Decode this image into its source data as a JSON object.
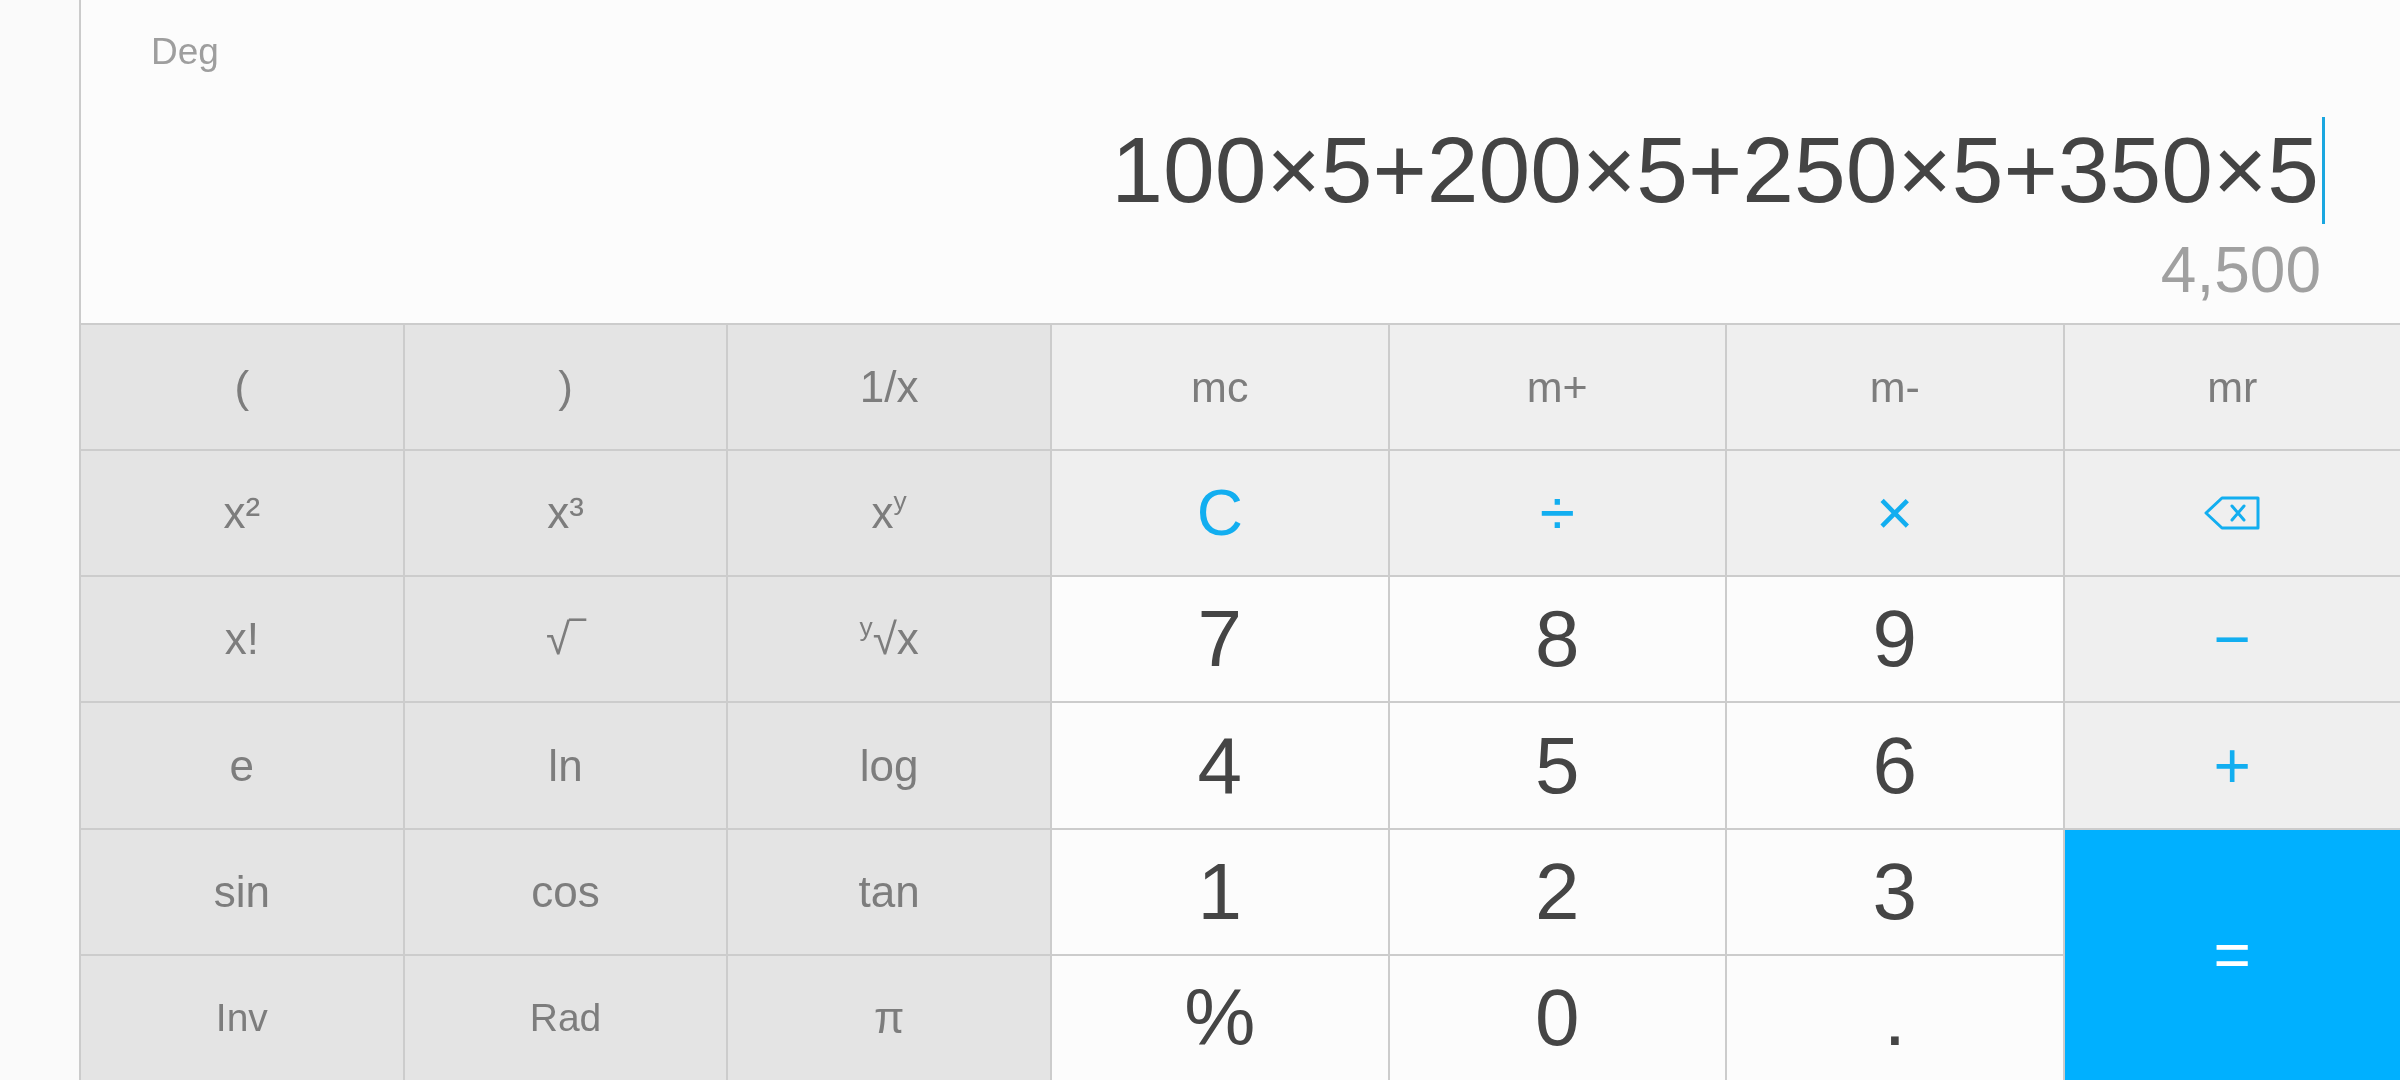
{
  "display": {
    "angle_mode": "Deg",
    "expression": "100×5+200×5+250×5+350×5",
    "result": "4,500"
  },
  "scientific_keys": [
    {
      "kind": "function",
      "label": "("
    },
    {
      "kind": "function",
      "label": ")"
    },
    {
      "kind": "function",
      "label": "1/x"
    },
    {
      "kind": "function",
      "label": "x²"
    },
    {
      "kind": "function",
      "label": "x³"
    },
    {
      "kind": "function",
      "label": "x$^{y}$"
    },
    {
      "kind": "function",
      "label": "x!"
    },
    {
      "kind": "function",
      "label": "√‾"
    },
    {
      "kind": "function",
      "label": "$^{y}$√x"
    },
    {
      "kind": "function",
      "label": "e"
    },
    {
      "kind": "function",
      "label": "ln"
    },
    {
      "kind": "function",
      "label": "log"
    },
    {
      "kind": "function",
      "label": "sin"
    },
    {
      "kind": "function",
      "label": "cos"
    },
    {
      "kind": "function",
      "label": "tan"
    },
    {
      "kind": "mode",
      "label": "Inv"
    },
    {
      "kind": "mode",
      "label": "Rad"
    },
    {
      "kind": "function",
      "label": "π"
    }
  ],
  "main_keys": [
    {
      "kind": "memory",
      "label": "mc"
    },
    {
      "kind": "memory",
      "label": "m+"
    },
    {
      "kind": "memory",
      "label": "m-"
    },
    {
      "kind": "memory",
      "label": "mr"
    },
    {
      "kind": "operator",
      "label": "C"
    },
    {
      "kind": "operator",
      "label": "÷"
    },
    {
      "kind": "operator",
      "label": "×"
    },
    {
      "kind": "backspace"
    },
    {
      "kind": "numpad",
      "label": "7"
    },
    {
      "kind": "numpad",
      "label": "8"
    },
    {
      "kind": "numpad",
      "label": "9"
    },
    {
      "kind": "operator",
      "label": "−"
    },
    {
      "kind": "numpad",
      "label": "4"
    },
    {
      "kind": "numpad",
      "label": "5"
    },
    {
      "kind": "numpad",
      "label": "6"
    },
    {
      "kind": "operator",
      "label": "+"
    },
    {
      "kind": "numpad",
      "label": "1"
    },
    {
      "kind": "numpad",
      "label": "2"
    },
    {
      "kind": "numpad",
      "label": "3"
    },
    {
      "kind": "equals",
      "label": "="
    },
    {
      "kind": "numpad",
      "label": "%"
    },
    {
      "kind": "numpad",
      "label": "0"
    },
    {
      "kind": "numpad",
      "label": "."
    }
  ]
}
